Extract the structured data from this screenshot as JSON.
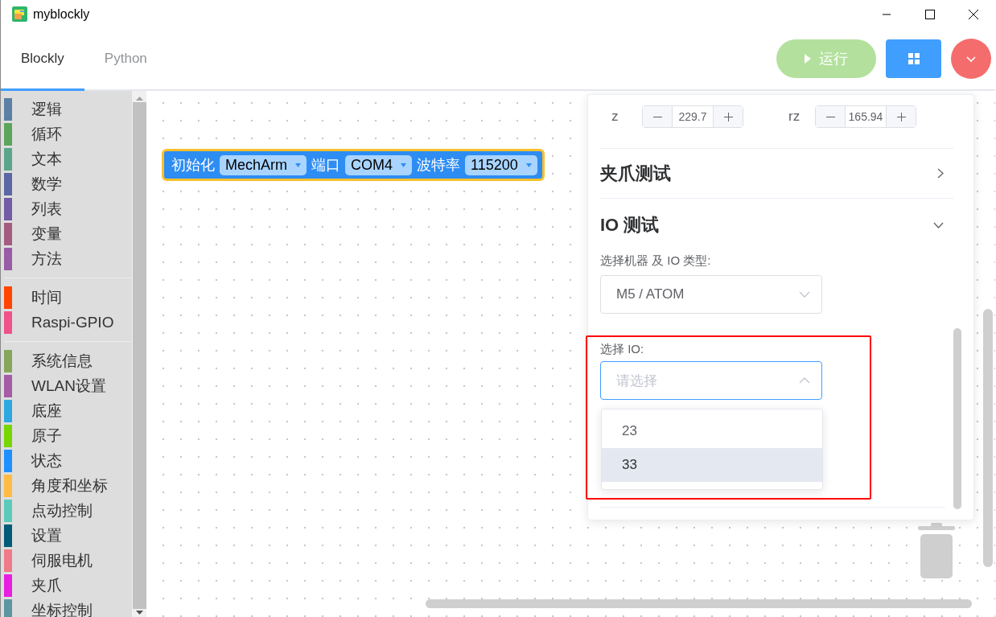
{
  "window": {
    "title": "myblockly"
  },
  "tabs": [
    {
      "label": "Blockly",
      "selected": true
    },
    {
      "label": "Python",
      "selected": false
    }
  ],
  "toolbar": {
    "run_button": {
      "label": "运行",
      "disabled": true
    }
  },
  "sidebar": {
    "groups": [
      {
        "items": [
          {
            "name": "逻辑",
            "color": "#5b80a5"
          },
          {
            "name": "循环",
            "color": "#5ba55b"
          },
          {
            "name": "文本",
            "color": "#5ba58c"
          },
          {
            "name": "数学",
            "color": "#5b67a5"
          },
          {
            "name": "列表",
            "color": "#745ba5"
          },
          {
            "name": "变量",
            "color": "#a55b80"
          },
          {
            "name": "方法",
            "color": "#995ba5"
          }
        ]
      },
      {
        "items": [
          {
            "name": "时间",
            "color": "#ff4500"
          },
          {
            "name": "Raspi-GPIO",
            "color": "#f0528a"
          }
        ]
      },
      {
        "items": [
          {
            "name": "系统信息",
            "color": "#86a65b"
          },
          {
            "name": "WLAN设置",
            "color": "#a65ba6"
          },
          {
            "name": "底座",
            "color": "#2ea8e0"
          },
          {
            "name": "原子",
            "color": "#76d600"
          },
          {
            "name": "状态",
            "color": "#1e90ff"
          },
          {
            "name": "角度和坐标",
            "color": "#ffbb44"
          },
          {
            "name": "点动控制",
            "color": "#5ccabb"
          },
          {
            "name": "设置",
            "color": "#005a78"
          },
          {
            "name": "伺服电机",
            "color": "#f07b88"
          },
          {
            "name": "夹爪",
            "color": "#e81ee0"
          },
          {
            "name": "坐标控制",
            "color": "#5c96a0"
          }
        ]
      }
    ]
  },
  "block": {
    "parts": [
      {
        "kind": "text",
        "text": "初始化"
      },
      {
        "kind": "dropdown",
        "text": "MechArm"
      },
      {
        "kind": "text",
        "text": "端口"
      },
      {
        "kind": "dropdown",
        "text": "COM4"
      },
      {
        "kind": "text",
        "text": "波特率"
      },
      {
        "kind": "dropdown",
        "text": "115200"
      }
    ]
  },
  "panel": {
    "coordinates": [
      {
        "label": "z",
        "value": "229.7"
      },
      {
        "label": "rz",
        "value": "165.94"
      }
    ],
    "sections": [
      {
        "title": "夹爪测试",
        "expanded": false
      },
      {
        "title": "IO 测试",
        "expanded": true
      }
    ],
    "machine_select": {
      "label": "选择机器 及 IO 类型:",
      "value": "M5 / ATOM"
    },
    "io_select": {
      "label": "选择 IO:",
      "placeholder": "请选择",
      "open": true,
      "options": [
        {
          "label": "23",
          "highlighted": false
        },
        {
          "label": "33",
          "highlighted": true
        }
      ]
    }
  }
}
